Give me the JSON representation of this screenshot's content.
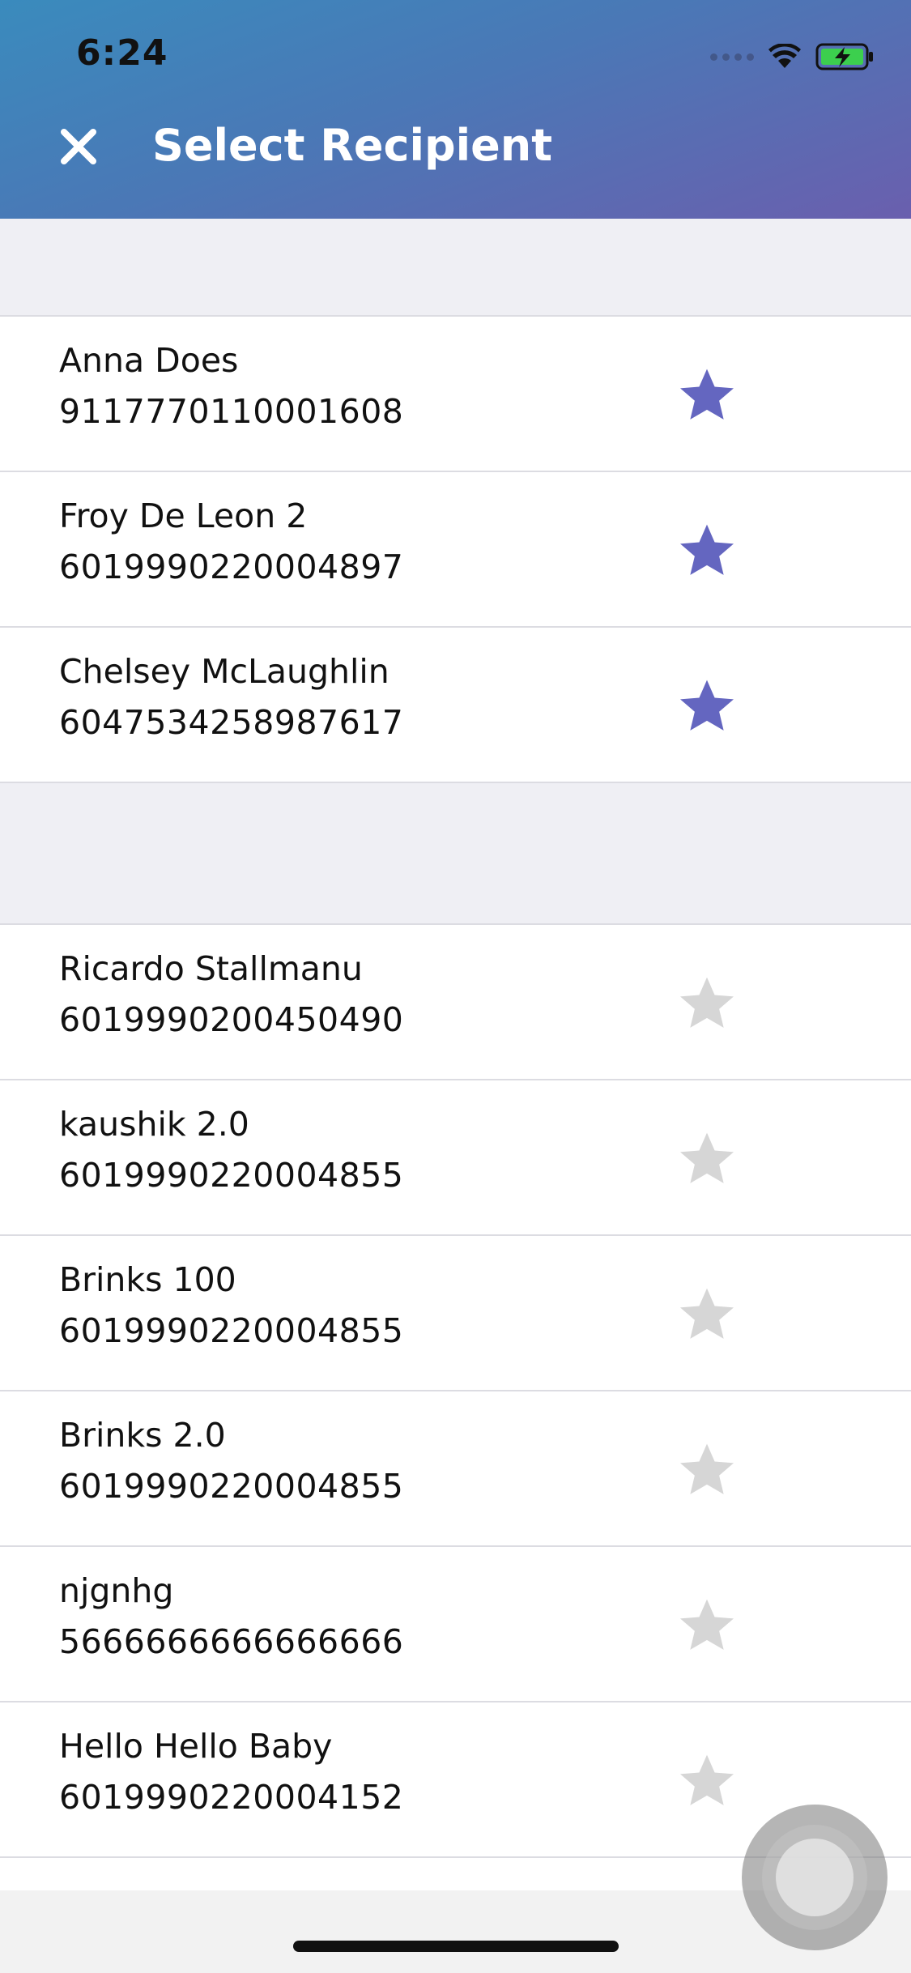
{
  "status_bar": {
    "time": "6:24",
    "icons": [
      "cellular-signal-icon",
      "wifi-icon",
      "battery-charging-icon"
    ]
  },
  "header": {
    "title": "Select Recipient",
    "close_icon": "close-icon",
    "gradient_colors": [
      "#3a8bbd",
      "#6a5fae"
    ]
  },
  "colors": {
    "favorite_star": "#6466c0",
    "unfavorite_star": "#d6d6d6",
    "section_background": "#efeff4"
  },
  "favorites": [
    {
      "name": "Anna Does",
      "number": "9117770110001608",
      "favorite": true
    },
    {
      "name": "Froy De Leon 2",
      "number": "6019990220004897",
      "favorite": true
    },
    {
      "name": "Chelsey McLaughlin",
      "number": "6047534258987617",
      "favorite": true
    }
  ],
  "recipients": [
    {
      "name": "Ricardo Stallmanu",
      "number": "6019990200450490",
      "favorite": false
    },
    {
      "name": "kaushik 2.0",
      "number": "6019990220004855",
      "favorite": false
    },
    {
      "name": "Brinks 100",
      "number": "6019990220004855",
      "favorite": false
    },
    {
      "name": "Brinks 2.0",
      "number": "6019990220004855",
      "favorite": false
    },
    {
      "name": "njgnhg",
      "number": "5666666666666666",
      "favorite": false
    },
    {
      "name": "Hello Hello Baby",
      "number": "6019990220004152",
      "favorite": false
    }
  ]
}
